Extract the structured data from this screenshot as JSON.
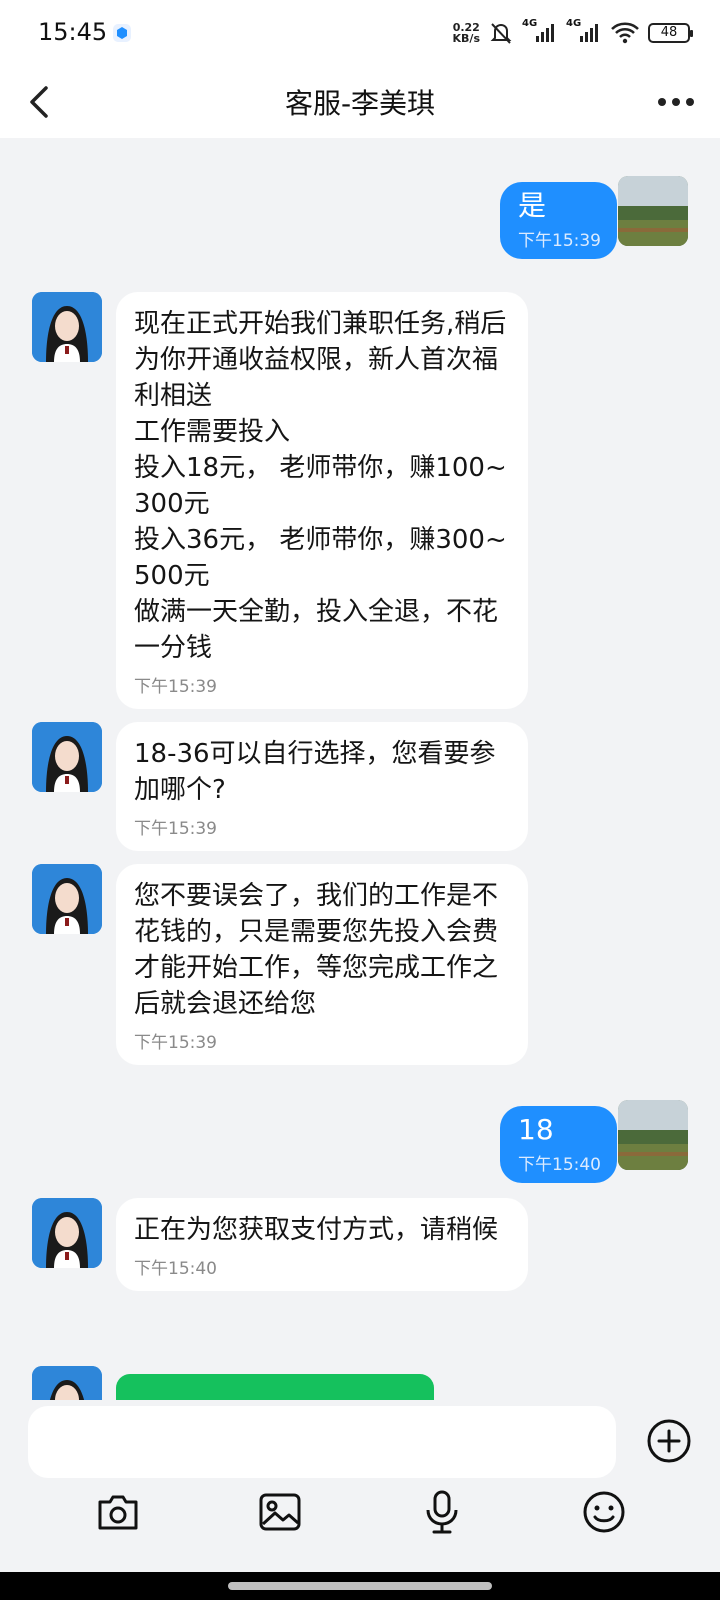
{
  "status_bar": {
    "time": "15:45",
    "net_speed_value": "0.22",
    "net_speed_unit": "KB/s",
    "sim1_type": "4G",
    "sim2_type": "4G",
    "battery": "48"
  },
  "header": {
    "title": "客服-李美琪"
  },
  "messages": [
    {
      "sender": "user",
      "text": "是",
      "time": "下午15:39"
    },
    {
      "sender": "agent",
      "text": "现在正式开始我们兼职任务,稍后为你开通收益权限，新人首次福利相送\n工作需要投入\n投入18元， 老师带你，赚100~300元\n投入36元， 老师带你，赚300~500元\n做满一天全勤，投入全退，不花一分钱",
      "time": "下午15:39"
    },
    {
      "sender": "agent",
      "text": "18-36可以自行选择，您看要参加哪个?",
      "time": "下午15:39"
    },
    {
      "sender": "agent",
      "text": "您不要误会了，我们的工作是不花钱的，只是需要您先投入会费才能开始工作，等您完成工作之后就会退还给您",
      "time": "下午15:39"
    },
    {
      "sender": "user",
      "text": "18",
      "time": "下午15:40"
    },
    {
      "sender": "agent",
      "text": "正在为您获取支付方式，请稍候",
      "time": "下午15:40"
    }
  ],
  "input": {
    "placeholder": ""
  },
  "colors": {
    "accent": "#1f8fff",
    "background": "#f2f3f5",
    "green_card": "#15c15d"
  },
  "icons": [
    "back-icon",
    "more-icon",
    "plus-icon",
    "camera-icon",
    "image-icon",
    "microphone-icon",
    "emoji-icon"
  ]
}
